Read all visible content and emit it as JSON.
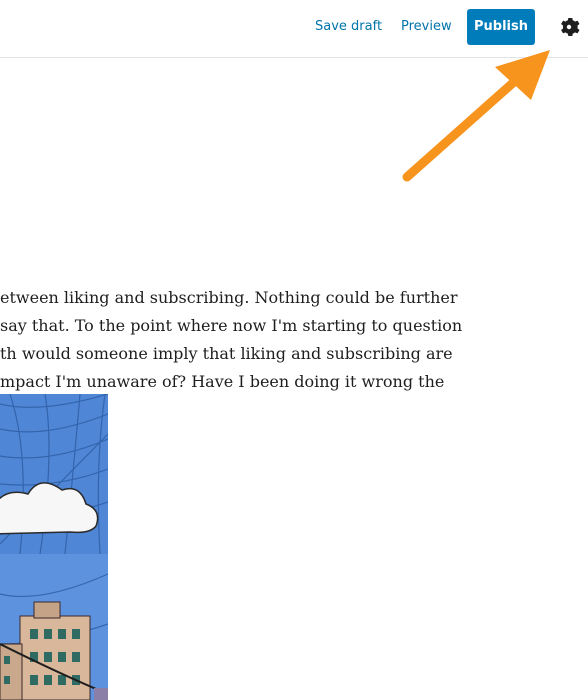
{
  "toolbar": {
    "save_draft": "Save draft",
    "preview": "Preview",
    "publish": "Publish",
    "settings_icon": "gear-icon"
  },
  "content": {
    "paragraph_lines": [
      "etween liking and subscribing. Nothing could be further",
      "say that. To the point where now I'm starting to question",
      "th would someone imply that liking and subscribing are",
      "mpact I'm unaware of? Have I been doing it wrong the"
    ]
  },
  "annotation": {
    "arrow_color": "#f7941d",
    "arrow_icon": "arrow-pointing-to-settings"
  },
  "colors": {
    "accent": "#007cba",
    "link": "#0073aa"
  }
}
